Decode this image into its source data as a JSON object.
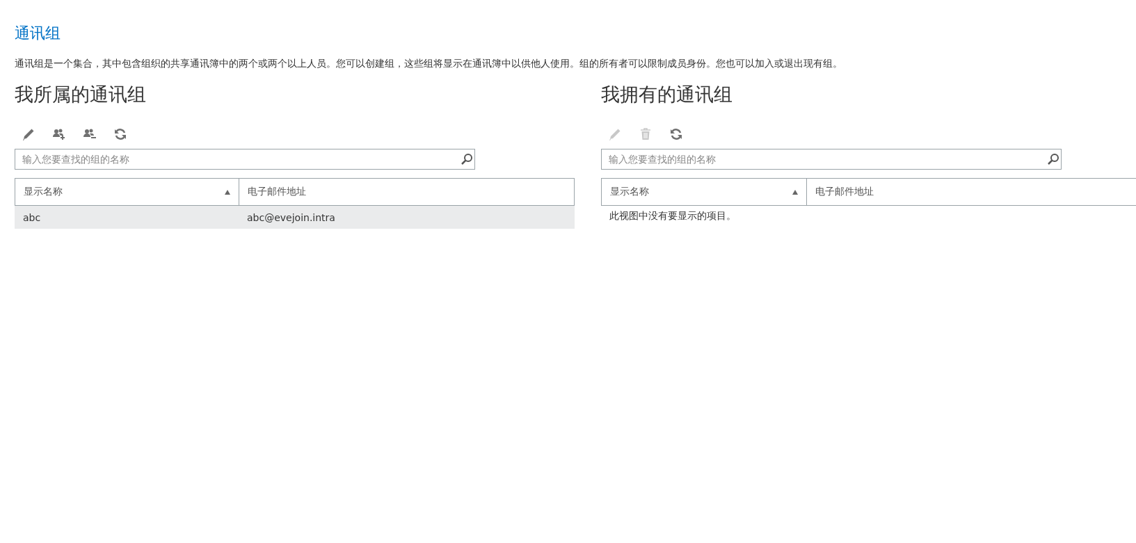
{
  "page": {
    "title": "通讯组",
    "description": "通讯组是一个集合，其中包含组织的共享通讯簿中的两个或两个以上人员。您可以创建组，这些组将显示在通讯簿中以供他人使用。组的所有者可以限制成员身份。您也可以加入或退出现有组。"
  },
  "panels": [
    {
      "heading": "我所属的通讯组",
      "toolbar": [
        {
          "kind": "edit",
          "disabled": false
        },
        {
          "kind": "join",
          "disabled": false
        },
        {
          "kind": "leave",
          "disabled": false
        },
        {
          "kind": "refresh",
          "disabled": false
        }
      ],
      "search": {
        "placeholder": "输入您要查找的组的名称"
      },
      "table": {
        "columns": [
          {
            "label": "显示名称",
            "sorted": true
          },
          {
            "label": "电子邮件地址",
            "sorted": false
          }
        ],
        "rows": [
          {
            "cells": [
              "abc",
              "abc@evejoin.intra"
            ],
            "selected": true
          }
        ]
      }
    },
    {
      "heading": "我拥有的通讯组",
      "toolbar": [
        {
          "kind": "edit",
          "disabled": true
        },
        {
          "kind": "delete",
          "disabled": true
        },
        {
          "kind": "refresh",
          "disabled": false
        }
      ],
      "search": {
        "placeholder": "输入您要查找的组的名称"
      },
      "table": {
        "columns": [
          {
            "label": "显示名称",
            "sorted": true
          },
          {
            "label": "电子邮件地址",
            "sorted": false
          }
        ],
        "empty_message": "此视图中没有要显示的项目。"
      }
    }
  ]
}
